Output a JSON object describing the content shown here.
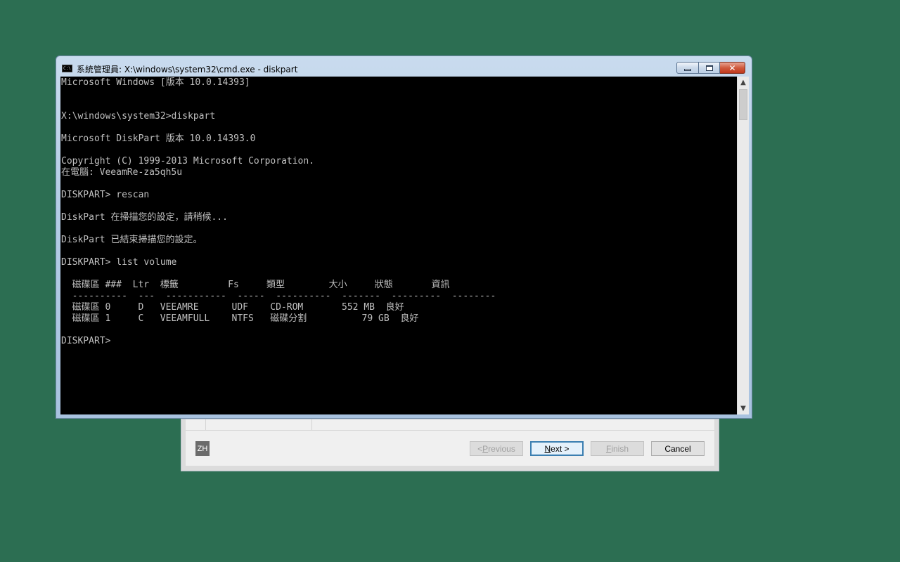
{
  "wizard": {
    "lang_badge": "ZH",
    "buttons": {
      "previous": {
        "prefix": "< ",
        "accel": "P",
        "rest": "revious"
      },
      "next": {
        "prefix": "",
        "accel": "N",
        "rest": "ext >"
      },
      "finish": {
        "prefix": "",
        "accel": "F",
        "rest": "inish"
      },
      "cancel": "Cancel"
    }
  },
  "console": {
    "title": "系統管理員: X:\\windows\\system32\\cmd.exe - diskpart",
    "icon_text": "C:\\",
    "lines": [
      "Microsoft Windows [版本 10.0.14393]",
      "",
      "",
      "X:\\windows\\system32>diskpart",
      "",
      "Microsoft DiskPart 版本 10.0.14393.0",
      "",
      "Copyright (C) 1999-2013 Microsoft Corporation.",
      "在電腦: VeeamRe-za5qh5u",
      "",
      "DISKPART> rescan",
      "",
      "DiskPart 在掃描您的設定，請稍候...",
      "",
      "DiskPart 已結束掃描您的設定。",
      "",
      "DISKPART> list volume",
      "",
      "  磁碟區 ###  Ltr  標籤         Fs     類型        大小     狀態       資訊",
      "  ----------  ---  -----------  -----  ----------  -------  ---------  --------",
      "  磁碟區 0     D   VEEAMRE      UDF    CD-ROM       552 MB  良好",
      "  磁碟區 1     C   VEEAMFULL    NTFS   磁碟分割          79 GB  良好",
      "",
      "DISKPART>"
    ]
  },
  "colors": {
    "desktop": "#2c6e52",
    "console_bg": "#000000",
    "console_fg": "#c0c0c0"
  }
}
